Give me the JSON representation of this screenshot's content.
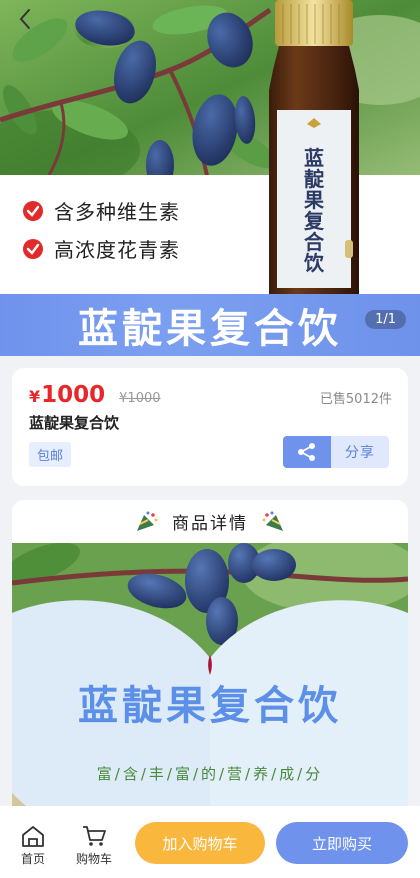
{
  "hero": {
    "bullets": [
      "含多种维生素",
      "高浓度花青素"
    ],
    "banner_title": "蓝靛果复合饮",
    "image_counter": "1/1",
    "bottle_label": "蓝靛果复合饮"
  },
  "product": {
    "currency": "¥",
    "price": "1000",
    "original_price": "¥1000",
    "sold": "已售5012件",
    "name": "蓝靛果复合饮",
    "tag": "包邮",
    "share_label": "分享"
  },
  "details": {
    "heading": "商品详情",
    "image_title": "蓝靛果复合饮",
    "image_subtitle": "富/含/丰/富/的/营/养/成/分"
  },
  "bottom_bar": {
    "home_label": "首页",
    "cart_label": "购物车",
    "add_to_cart_label": "加入购物车",
    "buy_now_label": "立即购买"
  },
  "colors": {
    "accent": "#6f93ec",
    "price": "#e8272a",
    "cart_button": "#f9b73d"
  }
}
